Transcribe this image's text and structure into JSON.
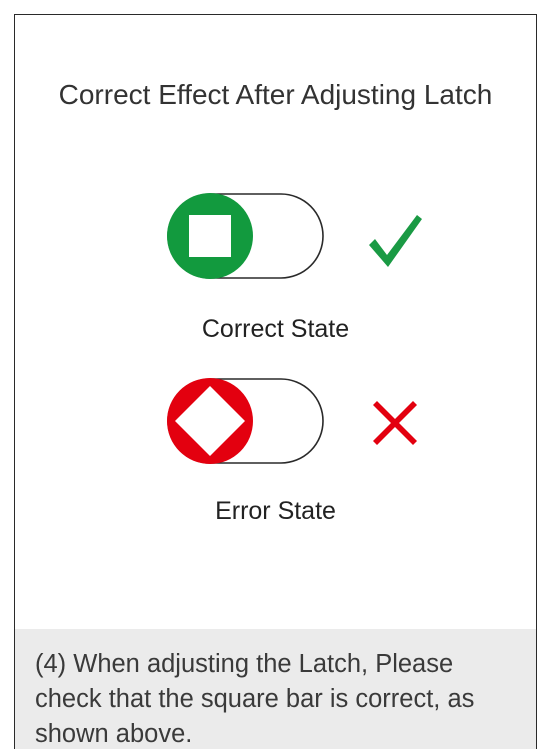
{
  "title": "Correct Effect After Adjusting Latch",
  "states": [
    {
      "label": "Correct State",
      "indicator_shape": "square",
      "indicator_color": "#129a3e",
      "mark": "check-mark",
      "mark_color": "#1a9a44"
    },
    {
      "label": "Error State",
      "indicator_shape": "diamond",
      "indicator_color": "#e3000f",
      "mark": "cross-mark",
      "mark_color": "#e3000f"
    }
  ],
  "caption": "(4) When adjusting the Latch, Please check that the square bar is correct, as shown above."
}
